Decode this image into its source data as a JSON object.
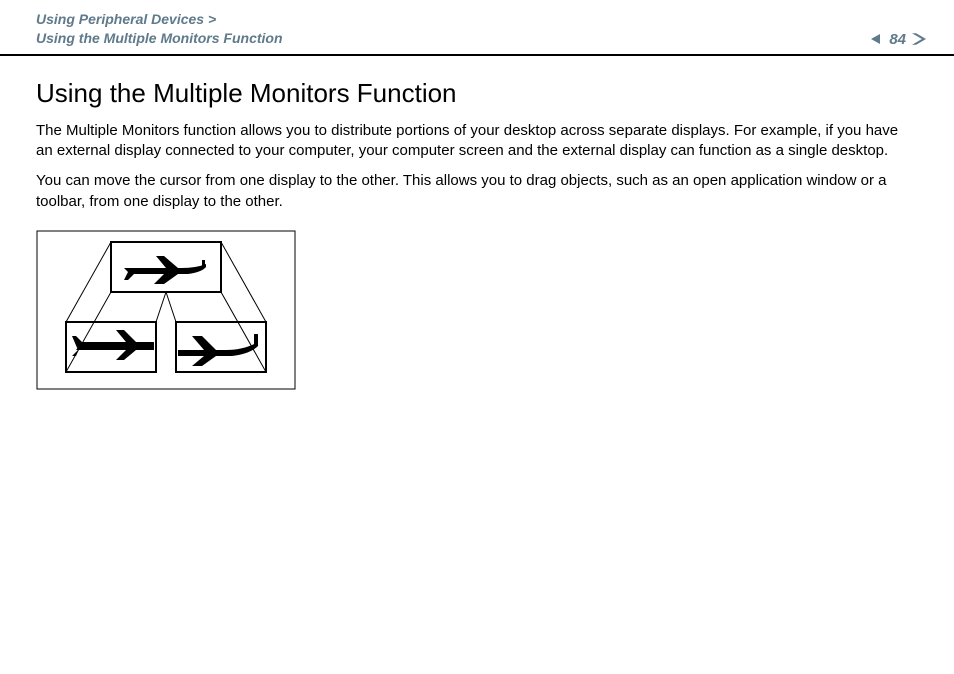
{
  "header": {
    "breadcrumb_parent": "Using Peripheral Devices",
    "breadcrumb_sep": ">",
    "breadcrumb_current": "Using the Multiple Monitors Function",
    "page_number": "84"
  },
  "body": {
    "title": "Using the Multiple Monitors Function",
    "para1": "The Multiple Monitors function allows you to distribute portions of your desktop across separate displays. For example, if you have an external display connected to your computer, your computer screen and the external display can function as a single desktop.",
    "para2": "You can move the cursor from one display to the other. This allows you to drag objects, such as an open application window or a toolbar, from one display to the other."
  },
  "figure": {
    "alt": "Diagram of a single large display showing an airplane and two smaller displays each showing part of the airplane, connected by projection lines."
  }
}
